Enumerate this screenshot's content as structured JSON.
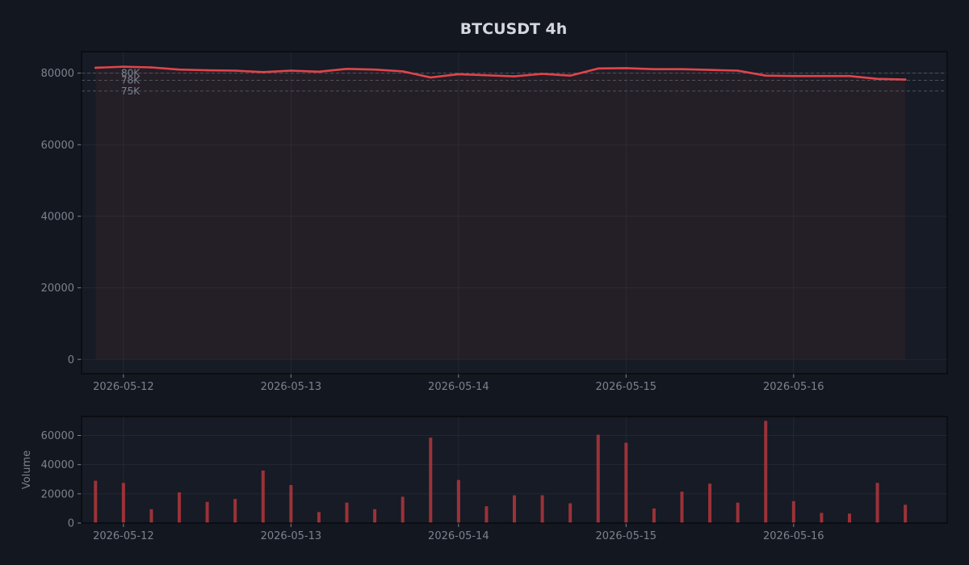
{
  "chart_data": [
    {
      "type": "line",
      "title": "BTCUSDT 4h",
      "xlabel": "",
      "ylabel": "",
      "ylim": [
        -4000,
        86000
      ],
      "xlim": [
        "2026-05-11T18:00",
        "2026-05-16T22:00"
      ],
      "x_tick_labels": [
        "2026-05-12",
        "2026-05-13",
        "2026-05-14",
        "2026-05-15",
        "2026-05-16"
      ],
      "y_tick_labels": [
        "0",
        "20000",
        "40000",
        "60000",
        "80000"
      ],
      "grid": true,
      "fill_area": true,
      "reference_lines": [
        {
          "label": "80K",
          "value": 80000
        },
        {
          "label": "78K",
          "value": 78000
        },
        {
          "label": "75K",
          "value": 75000
        }
      ],
      "series": [
        {
          "color": "#e0454b",
          "points": [
            {
              "x": "2026-05-11T20:00",
              "y": 81500
            },
            {
              "x": "2026-05-12T00:00",
              "y": 81800
            },
            {
              "x": "2026-05-12T04:00",
              "y": 81600
            },
            {
              "x": "2026-05-12T08:00",
              "y": 81000
            },
            {
              "x": "2026-05-12T12:00",
              "y": 80800
            },
            {
              "x": "2026-05-12T16:00",
              "y": 80700
            },
            {
              "x": "2026-05-12T20:00",
              "y": 80300
            },
            {
              "x": "2026-05-13T00:00",
              "y": 80700
            },
            {
              "x": "2026-05-13T04:00",
              "y": 80400
            },
            {
              "x": "2026-05-13T08:00",
              "y": 81200
            },
            {
              "x": "2026-05-13T12:00",
              "y": 81000
            },
            {
              "x": "2026-05-13T16:00",
              "y": 80500
            },
            {
              "x": "2026-05-13T20:00",
              "y": 78800
            },
            {
              "x": "2026-05-14T00:00",
              "y": 79700
            },
            {
              "x": "2026-05-14T04:00",
              "y": 79400
            },
            {
              "x": "2026-05-14T08:00",
              "y": 79100
            },
            {
              "x": "2026-05-14T12:00",
              "y": 79800
            },
            {
              "x": "2026-05-14T16:00",
              "y": 79300
            },
            {
              "x": "2026-05-14T20:00",
              "y": 81300
            },
            {
              "x": "2026-05-15T00:00",
              "y": 81400
            },
            {
              "x": "2026-05-15T04:00",
              "y": 81100
            },
            {
              "x": "2026-05-15T08:00",
              "y": 81100
            },
            {
              "x": "2026-05-15T12:00",
              "y": 80900
            },
            {
              "x": "2026-05-15T16:00",
              "y": 80700
            },
            {
              "x": "2026-05-15T20:00",
              "y": 79300
            },
            {
              "x": "2026-05-16T00:00",
              "y": 79200
            },
            {
              "x": "2026-05-16T04:00",
              "y": 79200
            },
            {
              "x": "2026-05-16T08:00",
              "y": 79200
            },
            {
              "x": "2026-05-16T12:00",
              "y": 78400
            },
            {
              "x": "2026-05-16T16:00",
              "y": 78200
            }
          ]
        }
      ]
    },
    {
      "type": "bar",
      "title": "",
      "xlabel": "",
      "ylabel": "Volume",
      "ylim": [
        0,
        73000
      ],
      "xlim": [
        "2026-05-11T18:00",
        "2026-05-16T22:00"
      ],
      "x_tick_labels": [
        "2026-05-12",
        "2026-05-13",
        "2026-05-14",
        "2026-05-15",
        "2026-05-16"
      ],
      "y_tick_labels": [
        "0",
        "20000",
        "40000",
        "60000"
      ],
      "grid": true,
      "series": [
        {
          "name": "Volume",
          "color": "#b3363c",
          "points": [
            {
              "x": "2026-05-11T20:00",
              "y": 29000
            },
            {
              "x": "2026-05-12T00:00",
              "y": 27500
            },
            {
              "x": "2026-05-12T04:00",
              "y": 9500
            },
            {
              "x": "2026-05-12T08:00",
              "y": 21000
            },
            {
              "x": "2026-05-12T12:00",
              "y": 14500
            },
            {
              "x": "2026-05-12T16:00",
              "y": 16500
            },
            {
              "x": "2026-05-12T20:00",
              "y": 36000
            },
            {
              "x": "2026-05-13T00:00",
              "y": 26000
            },
            {
              "x": "2026-05-13T04:00",
              "y": 7500
            },
            {
              "x": "2026-05-13T08:00",
              "y": 14000
            },
            {
              "x": "2026-05-13T12:00",
              "y": 9500
            },
            {
              "x": "2026-05-13T16:00",
              "y": 18000
            },
            {
              "x": "2026-05-13T20:00",
              "y": 58500
            },
            {
              "x": "2026-05-14T00:00",
              "y": 29500
            },
            {
              "x": "2026-05-14T04:00",
              "y": 11500
            },
            {
              "x": "2026-05-14T08:00",
              "y": 19000
            },
            {
              "x": "2026-05-14T12:00",
              "y": 19000
            },
            {
              "x": "2026-05-14T16:00",
              "y": 13500
            },
            {
              "x": "2026-05-14T20:00",
              "y": 60500
            },
            {
              "x": "2026-05-15T00:00",
              "y": 55000
            },
            {
              "x": "2026-05-15T04:00",
              "y": 10000
            },
            {
              "x": "2026-05-15T08:00",
              "y": 21500
            },
            {
              "x": "2026-05-15T12:00",
              "y": 27000
            },
            {
              "x": "2026-05-15T16:00",
              "y": 14000
            },
            {
              "x": "2026-05-15T20:00",
              "y": 70000
            },
            {
              "x": "2026-05-16T00:00",
              "y": 15000
            },
            {
              "x": "2026-05-16T04:00",
              "y": 7000
            },
            {
              "x": "2026-05-16T08:00",
              "y": 6500
            },
            {
              "x": "2026-05-16T12:00",
              "y": 27500
            },
            {
              "x": "2026-05-16T16:00",
              "y": 12500
            }
          ]
        }
      ]
    }
  ],
  "theme": {
    "background": "#131720",
    "plot_background": "#161b25",
    "axis_color": "#05070a",
    "grid_color": "#262b35",
    "line_color": "#e0454b",
    "fill_color": "#e0454b",
    "volume_color": "#b3363c",
    "text_color": "#d4d7de",
    "muted_text_color": "#7d828e"
  }
}
